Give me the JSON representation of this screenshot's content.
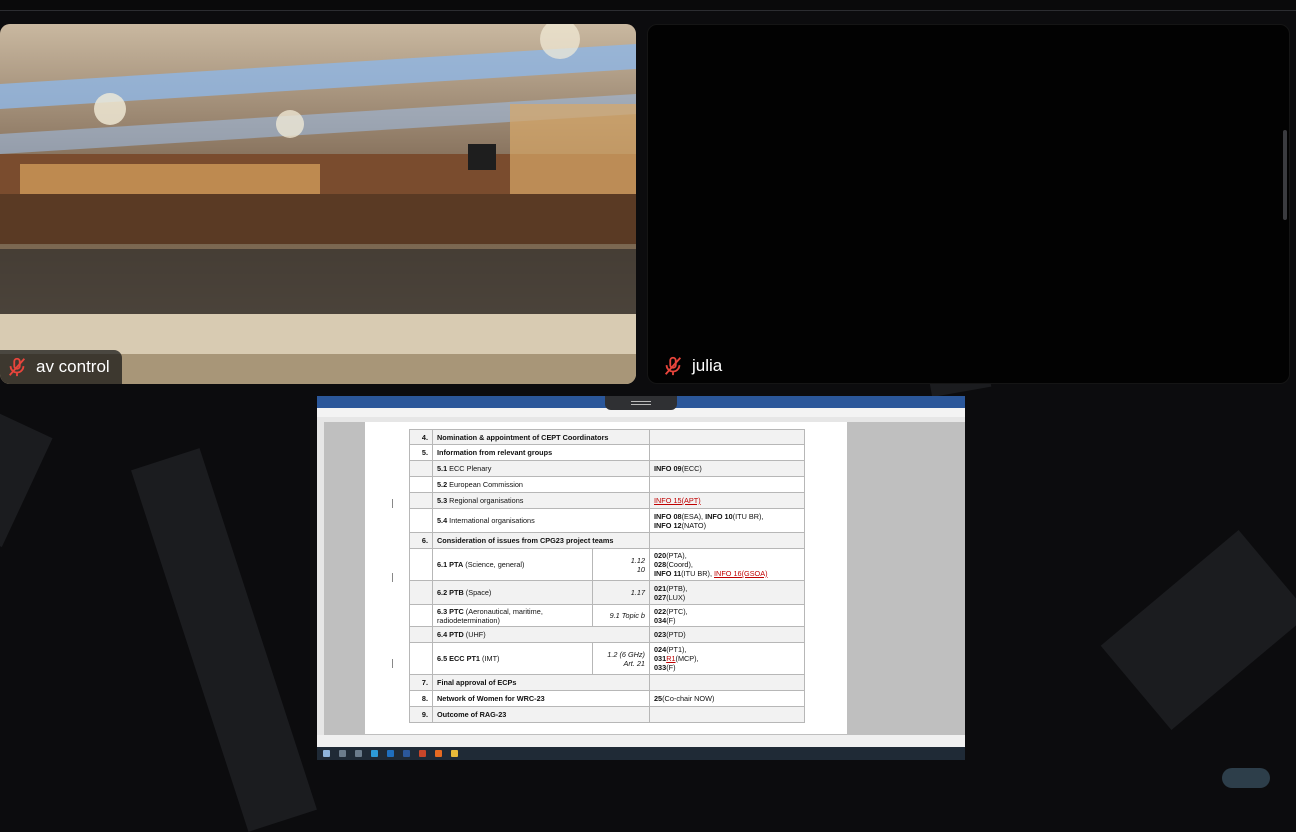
{
  "participants": [
    {
      "name": "av control",
      "muted": true
    },
    {
      "name": "julia",
      "muted": true
    }
  ],
  "shared_document": {
    "rows": [
      {
        "num": "4.",
        "title": "Nomination & appointment of CEPT Coordinators"
      },
      {
        "num": "5.",
        "title": "Information from relevant groups"
      },
      {
        "sub": "5.1",
        "label": "ECC Plenary",
        "doc_parts": [
          {
            "b": "INFO 09"
          },
          {
            "t": "(ECC)"
          }
        ]
      },
      {
        "sub": "5.2",
        "label": "European Commission"
      },
      {
        "sub": "5.3",
        "label": "Regional organisations",
        "doc_parts": [
          {
            "r": "INFO 15(APT)"
          }
        ]
      },
      {
        "sub": "5.4",
        "label": "International organisations",
        "doc_parts": [
          {
            "b": "INFO 08"
          },
          {
            "t": "(ESA), "
          },
          {
            "b": "INFO 10"
          },
          {
            "t": "(ITU BR),"
          },
          {
            "br": true
          },
          {
            "b": "INFO 12"
          },
          {
            "t": "(NATO)"
          }
        ]
      },
      {
        "num": "6.",
        "title": "Consideration of issues from CPG23 project teams"
      },
      {
        "sub": "6.1",
        "label": "PTA",
        "note": "(Science, general)",
        "items": [
          "1.12",
          "10"
        ],
        "doc_parts": [
          {
            "b": "020"
          },
          {
            "t": "(PTA),"
          },
          {
            "br": true
          },
          {
            "b": "028"
          },
          {
            "t": "(Coord),"
          },
          {
            "br": true
          },
          {
            "b": "INFO 11"
          },
          {
            "t": "(ITU BR), "
          },
          {
            "r": "INFO 16(GSOA)"
          }
        ]
      },
      {
        "sub": "6.2",
        "label": "PTB",
        "note": "(Space)",
        "items": [
          "1.17"
        ],
        "doc_parts": [
          {
            "b": "021"
          },
          {
            "t": "(PTB),"
          },
          {
            "br": true
          },
          {
            "b": "027"
          },
          {
            "t": "(LUX)"
          }
        ]
      },
      {
        "sub": "6.3",
        "label": "PTC",
        "note": "(Aeronautical, maritime,",
        "note2": "radiodetermination)",
        "items": [
          "9.1 Topic b"
        ],
        "doc_parts": [
          {
            "b": "022"
          },
          {
            "t": "(PTC),"
          },
          {
            "br": true
          },
          {
            "b": "034"
          },
          {
            "t": "(F)"
          }
        ]
      },
      {
        "sub": "6.4",
        "label": "PTD",
        "note": "(UHF)",
        "doc_parts": [
          {
            "b": "023"
          },
          {
            "t": "(PTD)"
          }
        ]
      },
      {
        "sub": "6.5",
        "label": "ECC PT1",
        "note": "(IMT)",
        "items": [
          "1.2 (6 GHz)",
          "Art. 21"
        ],
        "doc_parts": [
          {
            "b": "024"
          },
          {
            "t": "(PT1),"
          },
          {
            "br": true
          },
          {
            "b": "031"
          },
          {
            "r": "R1"
          },
          {
            "t": "(MCP),"
          },
          {
            "br": true
          },
          {
            "b": "033"
          },
          {
            "t": "(F)"
          }
        ]
      },
      {
        "num": "7.",
        "title": "Final approval of ECPs"
      },
      {
        "num": "8.",
        "title": "Network of Women for WRC-23",
        "doc_parts": [
          {
            "b": "25"
          },
          {
            "t": "(Co-chair NOW)"
          }
        ]
      },
      {
        "num": "9.",
        "title": "Outcome of RAG-23"
      }
    ]
  },
  "colors": {
    "background": "#0c0c0e",
    "stripe": "#1b1c1f",
    "word_blue": "#2b579a",
    "mic_off_red": "#e8453c",
    "link_red": "#c00000"
  },
  "icons": [
    "mic-off-icon",
    "share-handle-icon"
  ]
}
